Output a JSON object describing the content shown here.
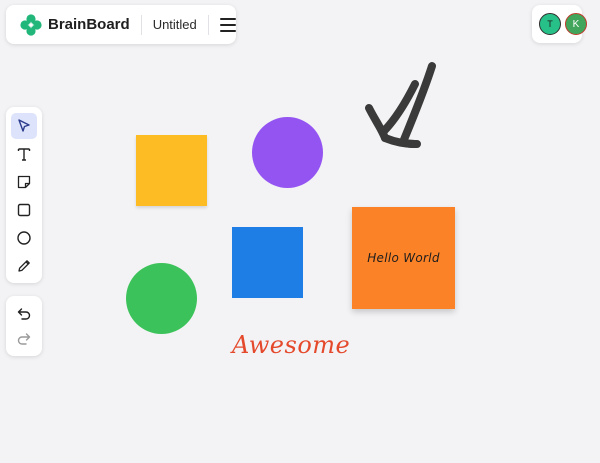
{
  "app": {
    "brand_name": "BrainBoard",
    "document_title": "Untitled"
  },
  "collaborators": [
    {
      "initial": "T",
      "color": "#27c088"
    },
    {
      "initial": "K",
      "color": "#41a65b"
    }
  ],
  "toolbar": {
    "tools": [
      {
        "name": "select",
        "icon": "pointer-icon",
        "active": true
      },
      {
        "name": "text",
        "icon": "text-icon",
        "active": false
      },
      {
        "name": "sticky-note",
        "icon": "sticky-note-icon",
        "active": false
      },
      {
        "name": "rectangle",
        "icon": "square-icon",
        "active": false
      },
      {
        "name": "ellipse",
        "icon": "circle-icon",
        "active": false
      },
      {
        "name": "pen",
        "icon": "pencil-icon",
        "active": false
      }
    ],
    "history": [
      {
        "name": "undo",
        "icon": "undo-icon"
      },
      {
        "name": "redo",
        "icon": "redo-icon"
      }
    ]
  },
  "canvas": {
    "shapes": [
      {
        "type": "square",
        "color": "#fdbc24"
      },
      {
        "type": "circle",
        "color": "#9454f2"
      },
      {
        "type": "square",
        "color": "#1f7ee6"
      },
      {
        "type": "circle",
        "color": "#3cc25a"
      }
    ],
    "sticky_note": {
      "text": "Hello World",
      "color": "#fc8227"
    },
    "handwritten_text": {
      "text": "Awesome",
      "color": "#e5492c"
    },
    "drawing": {
      "type": "arrow",
      "color": "#3a3a3a"
    }
  }
}
